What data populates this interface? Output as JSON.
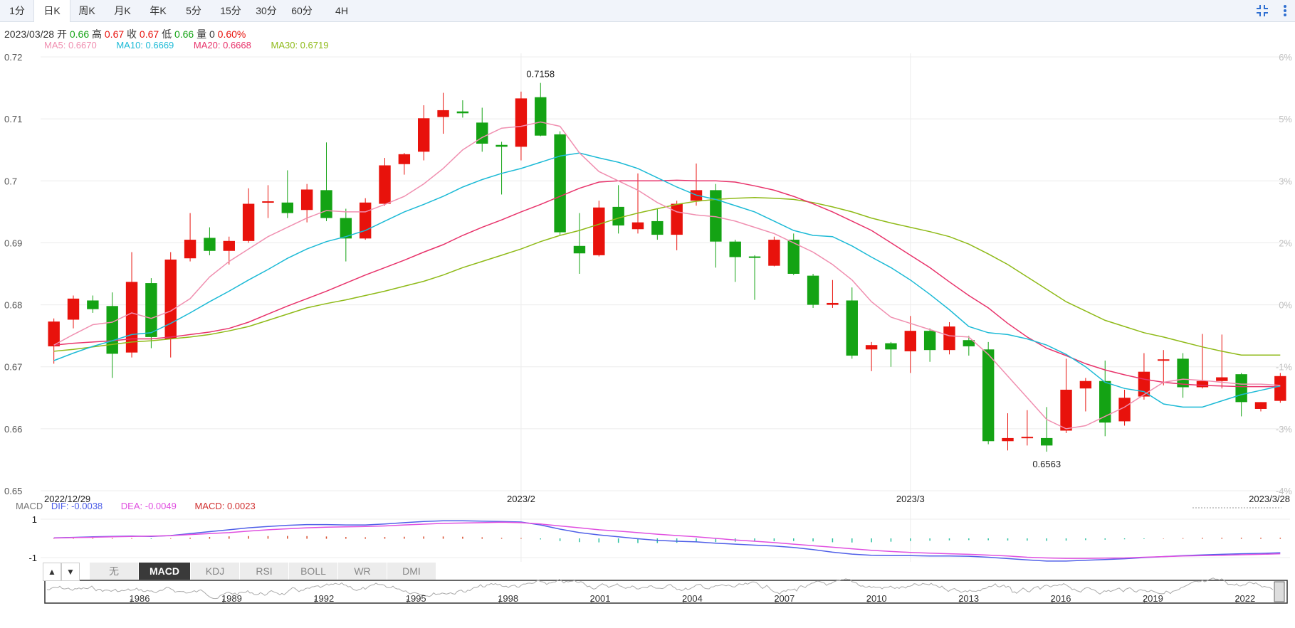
{
  "tabs": [
    {
      "label": "1分",
      "active": false
    },
    {
      "label": "日K",
      "active": true
    },
    {
      "label": "周K",
      "active": false
    },
    {
      "label": "月K",
      "active": false
    },
    {
      "label": "年K",
      "active": false
    },
    {
      "label": "5分",
      "active": false
    },
    {
      "label": "15分",
      "active": false
    },
    {
      "label": "30分",
      "active": false
    },
    {
      "label": "60分",
      "active": false
    },
    {
      "label": "4H",
      "active": false
    }
  ],
  "icons": {
    "collapse": "collapse-icon",
    "more": "more-vertical-icon"
  },
  "info": {
    "date": "2023/03/28",
    "open_label": "开",
    "open": "0.66",
    "high_label": "高",
    "high": "0.67",
    "close_label": "收",
    "close": "0.67",
    "low_label": "低",
    "low": "0.66",
    "volume_label": "量",
    "volume": "0",
    "change": "0.60%"
  },
  "ma_legend": [
    {
      "label": "MA5: 0.6670",
      "color": "#f08fb0"
    },
    {
      "label": "MA10: 0.6669",
      "color": "#1cbad6"
    },
    {
      "label": "MA20: 0.6668",
      "color": "#e8336b"
    },
    {
      "label": "MA30: 0.6719",
      "color": "#8fba18"
    }
  ],
  "macd_legend": {
    "name": "MACD",
    "dif": "DIF: -0.0038",
    "dea": "DEA: -0.0049",
    "macd": "MACD: 0.0023",
    "dif_color": "#4f5fe8",
    "dea_color": "#e050e0",
    "macd_color": "#d03030"
  },
  "indicator_tabs": [
    {
      "label": "无",
      "active": false
    },
    {
      "label": "MACD",
      "active": true
    },
    {
      "label": "KDJ",
      "active": false
    },
    {
      "label": "RSI",
      "active": false
    },
    {
      "label": "BOLL",
      "active": false
    },
    {
      "label": "WR",
      "active": false
    },
    {
      "label": "DMI",
      "active": false
    }
  ],
  "arrow_up": "▲",
  "arrow_down": "▼",
  "colors": {
    "up": "#e8120c",
    "down": "#14a314",
    "grid": "#ececec",
    "axis_text": "#555",
    "pct_text": "#c0c0c0"
  },
  "chart_data": {
    "type": "candlestick",
    "ylim": [
      0.65,
      0.72
    ],
    "y_ticks": [
      "0.72",
      "0.71",
      "0.7",
      "0.69",
      "0.68",
      "0.67",
      "0.66",
      "0.65"
    ],
    "pct_ticks": [
      "6%",
      "5%",
      "3%",
      "2%",
      "0%",
      "-1%",
      "-3%",
      "-4%"
    ],
    "x_labels": [
      "2022/12/29",
      "2023/2",
      "2023/3",
      "2023/3/28"
    ],
    "x_label_index": [
      0,
      24,
      44,
      63
    ],
    "high_annotation": "0.7158",
    "low_annotation": "0.6563",
    "candles": [
      {
        "o": 0.6733,
        "h": 0.6778,
        "l": 0.6705,
        "c": 0.6773
      },
      {
        "o": 0.6776,
        "h": 0.6815,
        "l": 0.6762,
        "c": 0.681
      },
      {
        "o": 0.6807,
        "h": 0.6815,
        "l": 0.6787,
        "c": 0.6793
      },
      {
        "o": 0.6798,
        "h": 0.682,
        "l": 0.6682,
        "c": 0.6721
      },
      {
        "o": 0.6723,
        "h": 0.6885,
        "l": 0.6715,
        "c": 0.6837
      },
      {
        "o": 0.6835,
        "h": 0.6843,
        "l": 0.673,
        "c": 0.6748
      },
      {
        "o": 0.6745,
        "h": 0.6885,
        "l": 0.6715,
        "c": 0.6873
      },
      {
        "o": 0.6875,
        "h": 0.6948,
        "l": 0.687,
        "c": 0.6905
      },
      {
        "o": 0.6908,
        "h": 0.6925,
        "l": 0.688,
        "c": 0.6887
      },
      {
        "o": 0.6887,
        "h": 0.691,
        "l": 0.6865,
        "c": 0.6903
      },
      {
        "o": 0.6903,
        "h": 0.6988,
        "l": 0.69,
        "c": 0.6963
      },
      {
        "o": 0.6965,
        "h": 0.6993,
        "l": 0.694,
        "c": 0.6967
      },
      {
        "o": 0.6965,
        "h": 0.7017,
        "l": 0.694,
        "c": 0.6948
      },
      {
        "o": 0.6953,
        "h": 0.6995,
        "l": 0.6933,
        "c": 0.6986
      },
      {
        "o": 0.6985,
        "h": 0.7062,
        "l": 0.6935,
        "c": 0.694
      },
      {
        "o": 0.694,
        "h": 0.6955,
        "l": 0.687,
        "c": 0.6907
      },
      {
        "o": 0.6907,
        "h": 0.6972,
        "l": 0.6905,
        "c": 0.6965
      },
      {
        "o": 0.6963,
        "h": 0.7037,
        "l": 0.696,
        "c": 0.7025
      },
      {
        "o": 0.7027,
        "h": 0.7045,
        "l": 0.701,
        "c": 0.7043
      },
      {
        "o": 0.7047,
        "h": 0.7122,
        "l": 0.7033,
        "c": 0.7101
      },
      {
        "o": 0.7103,
        "h": 0.7142,
        "l": 0.7076,
        "c": 0.7114
      },
      {
        "o": 0.7112,
        "h": 0.713,
        "l": 0.7102,
        "c": 0.7109
      },
      {
        "o": 0.7094,
        "h": 0.7118,
        "l": 0.7047,
        "c": 0.706
      },
      {
        "o": 0.7058,
        "h": 0.7063,
        "l": 0.6978,
        "c": 0.7055
      },
      {
        "o": 0.7055,
        "h": 0.7144,
        "l": 0.7033,
        "c": 0.7133
      },
      {
        "o": 0.7135,
        "h": 0.7158,
        "l": 0.7072,
        "c": 0.7073
      },
      {
        "o": 0.7075,
        "h": 0.708,
        "l": 0.6913,
        "c": 0.6917
      },
      {
        "o": 0.6895,
        "h": 0.6948,
        "l": 0.685,
        "c": 0.6883
      },
      {
        "o": 0.688,
        "h": 0.6968,
        "l": 0.6878,
        "c": 0.6957
      },
      {
        "o": 0.6958,
        "h": 0.6993,
        "l": 0.6915,
        "c": 0.6928
      },
      {
        "o": 0.6922,
        "h": 0.7012,
        "l": 0.6915,
        "c": 0.6933
      },
      {
        "o": 0.6935,
        "h": 0.6955,
        "l": 0.6905,
        "c": 0.6913
      },
      {
        "o": 0.6913,
        "h": 0.6968,
        "l": 0.6888,
        "c": 0.6963
      },
      {
        "o": 0.6968,
        "h": 0.7028,
        "l": 0.696,
        "c": 0.6985
      },
      {
        "o": 0.6985,
        "h": 0.6995,
        "l": 0.686,
        "c": 0.6902
      },
      {
        "o": 0.6902,
        "h": 0.6905,
        "l": 0.6837,
        "c": 0.6877
      },
      {
        "o": 0.6878,
        "h": 0.688,
        "l": 0.6808,
        "c": 0.6877
      },
      {
        "o": 0.6863,
        "h": 0.691,
        "l": 0.6862,
        "c": 0.6905
      },
      {
        "o": 0.6905,
        "h": 0.6915,
        "l": 0.6848,
        "c": 0.685
      },
      {
        "o": 0.6847,
        "h": 0.685,
        "l": 0.6795,
        "c": 0.68
      },
      {
        "o": 0.68,
        "h": 0.684,
        "l": 0.6795,
        "c": 0.6803
      },
      {
        "o": 0.6807,
        "h": 0.6828,
        "l": 0.6713,
        "c": 0.6718
      },
      {
        "o": 0.6728,
        "h": 0.674,
        "l": 0.6693,
        "c": 0.6735
      },
      {
        "o": 0.6738,
        "h": 0.674,
        "l": 0.67,
        "c": 0.6728
      },
      {
        "o": 0.6725,
        "h": 0.6782,
        "l": 0.669,
        "c": 0.6758
      },
      {
        "o": 0.6758,
        "h": 0.6762,
        "l": 0.6708,
        "c": 0.6727
      },
      {
        "o": 0.6727,
        "h": 0.6772,
        "l": 0.672,
        "c": 0.6765
      },
      {
        "o": 0.6743,
        "h": 0.675,
        "l": 0.6718,
        "c": 0.6733
      },
      {
        "o": 0.6728,
        "h": 0.674,
        "l": 0.6575,
        "c": 0.658
      },
      {
        "o": 0.658,
        "h": 0.6625,
        "l": 0.6565,
        "c": 0.6585
      },
      {
        "o": 0.6587,
        "h": 0.663,
        "l": 0.6573,
        "c": 0.6587
      },
      {
        "o": 0.6585,
        "h": 0.6635,
        "l": 0.6563,
        "c": 0.6573
      },
      {
        "o": 0.6597,
        "h": 0.6713,
        "l": 0.6593,
        "c": 0.6663
      },
      {
        "o": 0.6665,
        "h": 0.6682,
        "l": 0.6628,
        "c": 0.6677
      },
      {
        "o": 0.6677,
        "h": 0.671,
        "l": 0.6588,
        "c": 0.661
      },
      {
        "o": 0.6612,
        "h": 0.6663,
        "l": 0.6605,
        "c": 0.665
      },
      {
        "o": 0.6652,
        "h": 0.6722,
        "l": 0.6647,
        "c": 0.6692
      },
      {
        "o": 0.6712,
        "h": 0.6727,
        "l": 0.667,
        "c": 0.6712
      },
      {
        "o": 0.6713,
        "h": 0.6722,
        "l": 0.665,
        "c": 0.6667
      },
      {
        "o": 0.6667,
        "h": 0.6753,
        "l": 0.6665,
        "c": 0.6677
      },
      {
        "o": 0.6677,
        "h": 0.6752,
        "l": 0.6665,
        "c": 0.6683
      },
      {
        "o": 0.6688,
        "h": 0.669,
        "l": 0.662,
        "c": 0.6643
      },
      {
        "o": 0.6632,
        "h": 0.6643,
        "l": 0.6628,
        "c": 0.6643
      },
      {
        "o": 0.6645,
        "h": 0.669,
        "l": 0.6642,
        "c": 0.6685
      }
    ],
    "ma5": [
      0.6735,
      0.6752,
      0.6768,
      0.6772,
      0.6787,
      0.6778,
      0.679,
      0.681,
      0.6845,
      0.687,
      0.689,
      0.691,
      0.6925,
      0.694,
      0.6952,
      0.695,
      0.695,
      0.6962,
      0.6975,
      0.6995,
      0.702,
      0.705,
      0.707,
      0.7085,
      0.7088,
      0.7095,
      0.7088,
      0.7045,
      0.7015,
      0.7,
      0.6985,
      0.6965,
      0.695,
      0.6945,
      0.6942,
      0.6935,
      0.6925,
      0.6915,
      0.69,
      0.6885,
      0.6865,
      0.684,
      0.6805,
      0.678,
      0.677,
      0.676,
      0.675,
      0.6748,
      0.672,
      0.6685,
      0.665,
      0.6615,
      0.66,
      0.6605,
      0.662,
      0.6635,
      0.6655,
      0.6675,
      0.668,
      0.6678,
      0.6675,
      0.6672,
      0.6672,
      0.667
    ],
    "ma10": [
      0.671,
      0.6722,
      0.6733,
      0.6742,
      0.6752,
      0.6755,
      0.677,
      0.6787,
      0.6805,
      0.6822,
      0.684,
      0.6857,
      0.6875,
      0.689,
      0.6902,
      0.691,
      0.692,
      0.6935,
      0.695,
      0.6962,
      0.6975,
      0.699,
      0.7002,
      0.7012,
      0.702,
      0.703,
      0.704,
      0.7045,
      0.7037,
      0.703,
      0.702,
      0.7005,
      0.699,
      0.6977,
      0.697,
      0.696,
      0.695,
      0.6935,
      0.692,
      0.6912,
      0.691,
      0.6895,
      0.6877,
      0.686,
      0.684,
      0.6817,
      0.6792,
      0.6765,
      0.6755,
      0.6752,
      0.6745,
      0.6735,
      0.672,
      0.67,
      0.6675,
      0.6665,
      0.666,
      0.664,
      0.6635,
      0.6635,
      0.6645,
      0.6655,
      0.6662,
      0.6669
    ],
    "ma20": [
      0.6735,
      0.6738,
      0.674,
      0.6742,
      0.6745,
      0.6745,
      0.6748,
      0.6752,
      0.6756,
      0.6762,
      0.6772,
      0.6785,
      0.6798,
      0.681,
      0.6822,
      0.6835,
      0.6848,
      0.686,
      0.6872,
      0.6885,
      0.6897,
      0.6912,
      0.6925,
      0.6937,
      0.695,
      0.6962,
      0.6975,
      0.6988,
      0.6998,
      0.7,
      0.7,
      0.7,
      0.7001,
      0.7,
      0.7,
      0.6998,
      0.6992,
      0.6985,
      0.6975,
      0.6963,
      0.695,
      0.6935,
      0.692,
      0.69,
      0.688,
      0.686,
      0.6837,
      0.6815,
      0.6795,
      0.677,
      0.6748,
      0.673,
      0.6718,
      0.6705,
      0.6695,
      0.6687,
      0.668,
      0.6675,
      0.6672,
      0.667,
      0.6669,
      0.6668,
      0.6668,
      0.6668
    ],
    "ma30": [
      0.6725,
      0.6728,
      0.6732,
      0.6736,
      0.674,
      0.6742,
      0.6745,
      0.6748,
      0.6752,
      0.6758,
      0.6765,
      0.6775,
      0.6785,
      0.6795,
      0.6802,
      0.6808,
      0.6815,
      0.6822,
      0.683,
      0.6838,
      0.6848,
      0.686,
      0.687,
      0.688,
      0.689,
      0.6902,
      0.6912,
      0.692,
      0.693,
      0.694,
      0.6948,
      0.6955,
      0.6962,
      0.6967,
      0.697,
      0.6972,
      0.6973,
      0.6972,
      0.697,
      0.6965,
      0.6958,
      0.695,
      0.694,
      0.6932,
      0.6925,
      0.6918,
      0.691,
      0.6898,
      0.6882,
      0.6865,
      0.6845,
      0.6825,
      0.6805,
      0.679,
      0.6775,
      0.6765,
      0.6755,
      0.6748,
      0.674,
      0.6732,
      0.6725,
      0.6719,
      0.6719,
      0.6719
    ],
    "macd_ylim": [
      -1,
      1
    ],
    "macd_ticks": [
      "1",
      "-1"
    ],
    "dif": [
      0.03,
      0.05,
      0.08,
      0.1,
      0.12,
      0.1,
      0.15,
      0.25,
      0.35,
      0.45,
      0.55,
      0.62,
      0.68,
      0.72,
      0.72,
      0.7,
      0.7,
      0.75,
      0.82,
      0.88,
      0.92,
      0.92,
      0.9,
      0.88,
      0.85,
      0.7,
      0.48,
      0.3,
      0.18,
      0.08,
      -0.02,
      -0.1,
      -0.15,
      -0.18,
      -0.25,
      -0.3,
      -0.35,
      -0.4,
      -0.47,
      -0.58,
      -0.72,
      -0.82,
      -0.88,
      -0.9,
      -0.9,
      -0.92,
      -0.92,
      -0.93,
      -0.98,
      -1.05,
      -1.12,
      -1.18,
      -1.18,
      -1.14,
      -1.1,
      -1.06,
      -1.0,
      -0.95,
      -0.9,
      -0.86,
      -0.83,
      -0.8,
      -0.78,
      -0.75
    ],
    "dea": [
      0.02,
      0.04,
      0.06,
      0.08,
      0.1,
      0.12,
      0.14,
      0.2,
      0.25,
      0.3,
      0.38,
      0.45,
      0.5,
      0.55,
      0.58,
      0.6,
      0.62,
      0.65,
      0.7,
      0.74,
      0.78,
      0.8,
      0.82,
      0.84,
      0.82,
      0.75,
      0.65,
      0.55,
      0.45,
      0.38,
      0.3,
      0.22,
      0.15,
      0.08,
      0.0,
      -0.08,
      -0.15,
      -0.22,
      -0.3,
      -0.38,
      -0.46,
      -0.54,
      -0.62,
      -0.68,
      -0.73,
      -0.77,
      -0.8,
      -0.83,
      -0.87,
      -0.92,
      -0.98,
      -1.02,
      -1.04,
      -1.04,
      -1.03,
      -1.02,
      -0.98,
      -0.95,
      -0.92,
      -0.9,
      -0.88,
      -0.85,
      -0.83,
      -0.8
    ],
    "macd": [
      0.02,
      0.02,
      0.04,
      0.04,
      0.04,
      -0.04,
      0.02,
      0.1,
      0.2,
      0.3,
      0.34,
      0.34,
      0.36,
      0.34,
      0.28,
      0.2,
      0.16,
      0.2,
      0.24,
      0.28,
      0.28,
      0.24,
      0.16,
      0.08,
      0.06,
      -0.1,
      -0.34,
      -0.5,
      -0.54,
      -0.6,
      -0.64,
      -0.64,
      -0.6,
      -0.52,
      -0.5,
      -0.44,
      -0.4,
      -0.36,
      -0.34,
      -0.4,
      -0.52,
      -0.56,
      -0.52,
      -0.44,
      -0.34,
      -0.3,
      -0.24,
      -0.2,
      -0.22,
      -0.26,
      -0.28,
      -0.32,
      -0.28,
      -0.2,
      -0.14,
      -0.08,
      -0.04,
      0.0,
      0.04,
      0.08,
      0.1,
      0.1,
      0.1,
      0.1
    ]
  },
  "navigator": {
    "years": [
      "1986",
      "1989",
      "1992",
      "1995",
      "1998",
      "2001",
      "2004",
      "2007",
      "2010",
      "2013",
      "2016",
      "2019",
      "2022"
    ]
  }
}
